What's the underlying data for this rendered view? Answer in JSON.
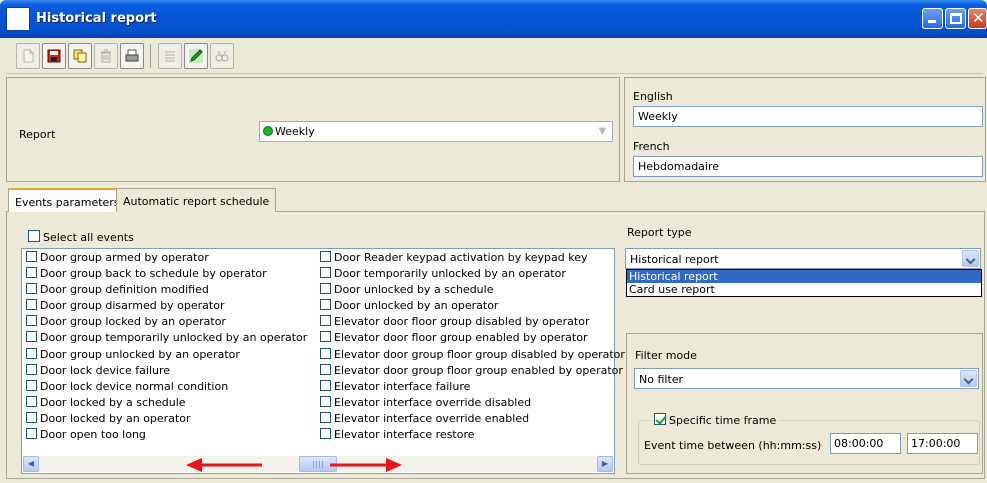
{
  "window": {
    "title": "Historical report"
  },
  "toolbar": {
    "buttons": [
      "new-icon",
      "save-icon",
      "copy-icon",
      "delete-icon",
      "print-icon",
      "list-icon",
      "edit-icon",
      "find-icon"
    ]
  },
  "report": {
    "label": "Report",
    "value": "Weekly"
  },
  "languages": {
    "english_label": "English",
    "english_value": "Weekly",
    "french_label": "French",
    "french_value": "Hebdomadaire"
  },
  "tabs": [
    {
      "label": "Events parameters"
    },
    {
      "label": "Automatic report schedule"
    }
  ],
  "events": {
    "select_all_label": "Select all events",
    "col1": [
      "Door group armed by operator",
      "Door group back to schedule by operator",
      "Door group definition modified",
      "Door group disarmed by operator",
      "Door group locked by an operator",
      "Door group temporarily unlocked by an operator",
      "Door group unlocked by an operator",
      "Door lock device failure",
      "Door lock device normal condition",
      "Door locked by a schedule",
      "Door locked by an operator",
      "Door open too long"
    ],
    "col2": [
      "Door Reader keypad activation by keypad key",
      "Door temporarily unlocked by an operator",
      "Door unlocked by a schedule",
      "Door unlocked by an operator",
      "Elevator door floor group disabled by operator",
      "Elevator door floor group enabled by operator",
      "Elevator door group floor group disabled by operator",
      "Elevator door group floor group enabled by operator",
      "Elevator interface failure",
      "Elevator interface override disabled",
      "Elevator interface override enabled",
      "Elevator interface restore"
    ]
  },
  "report_type": {
    "label": "Report type",
    "value": "Historical report",
    "options": [
      "Historical report",
      "Card use report"
    ]
  },
  "filter": {
    "label": "Filter mode",
    "value": "No filter",
    "time_frame_label": "Specific time frame",
    "time_between_label": "Event time between (hh:mm:ss)",
    "start_time": "08:00:00",
    "end_time": "17:00:00"
  },
  "colors": {
    "titlebar": "#0454d4",
    "selection": "#316ac5",
    "arrow": "#e8141c"
  }
}
